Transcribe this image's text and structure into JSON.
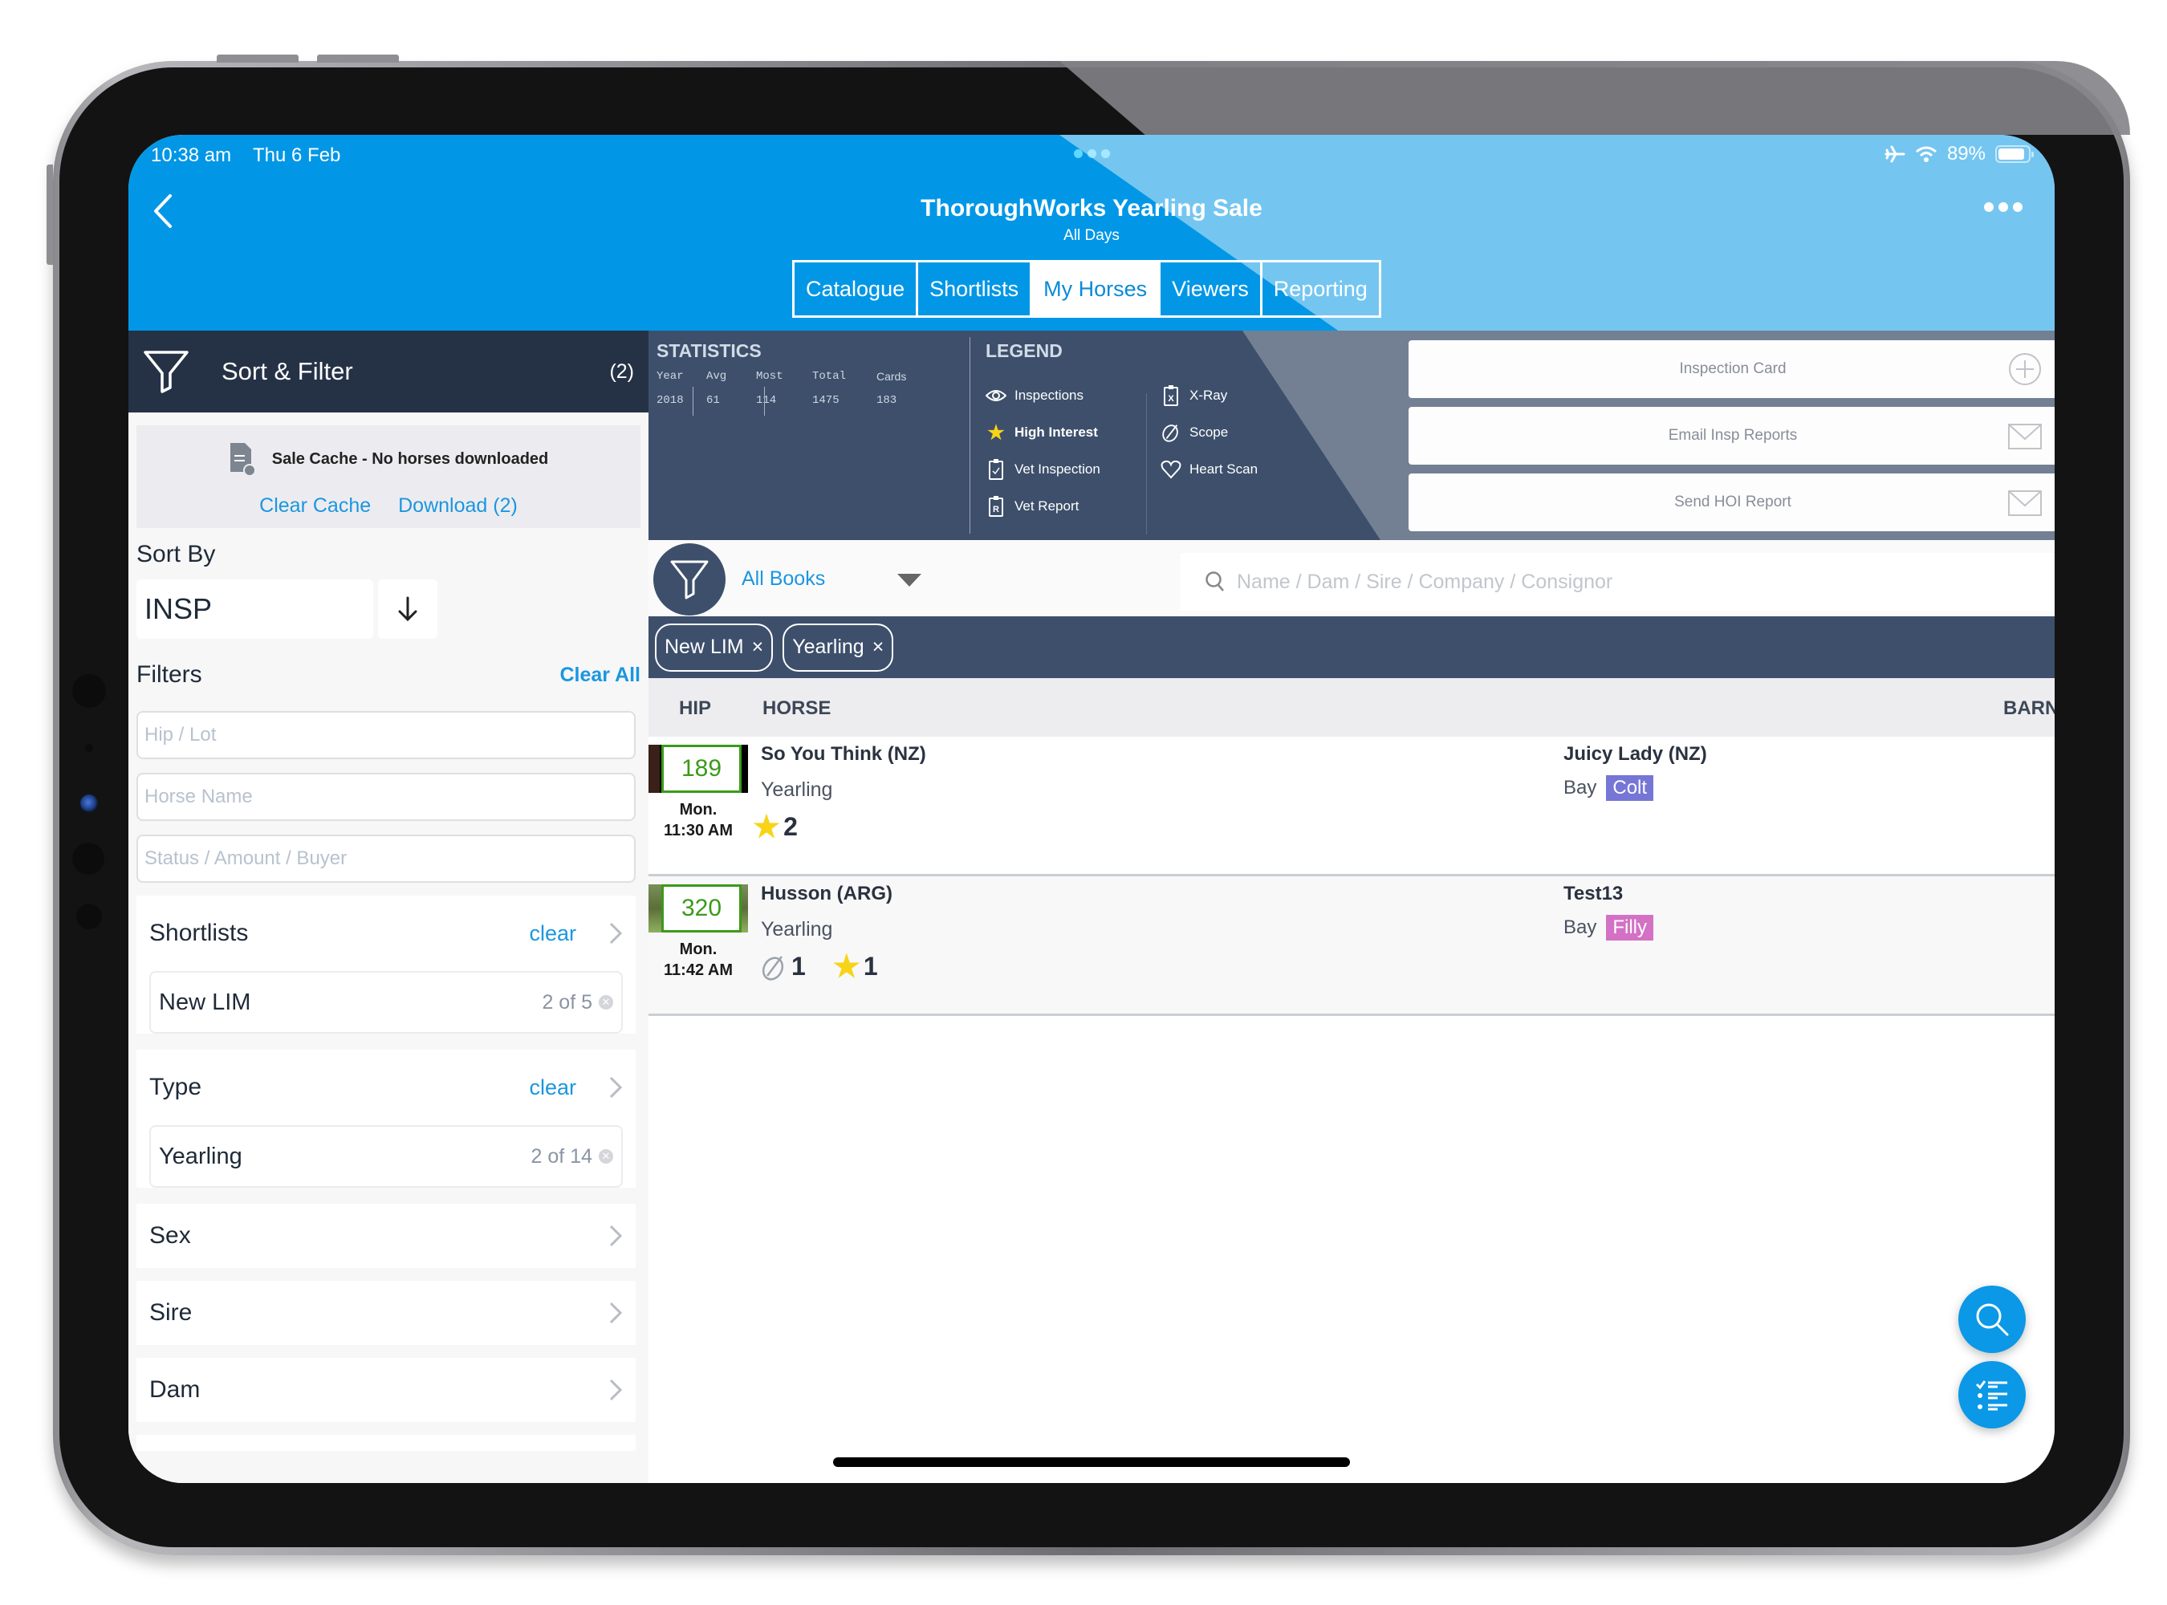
{
  "status_bar": {
    "time": "10:38 am",
    "date": "Thu 6 Feb",
    "battery": "89%",
    "battery_level_percent": 89
  },
  "header": {
    "title": "ThoroughWorks Yearling Sale",
    "subtitle": "All Days",
    "tabs": [
      {
        "label": "Catalogue",
        "active": false
      },
      {
        "label": "Shortlists",
        "active": false
      },
      {
        "label": "My Horses",
        "active": true
      },
      {
        "label": "Viewers",
        "active": false
      },
      {
        "label": "Reporting",
        "active": false
      }
    ]
  },
  "sidebar": {
    "title": "Sort & Filter",
    "count": "(2)",
    "cache": {
      "message": "Sale Cache - No horses downloaded",
      "clear_label": "Clear Cache",
      "download_label": "Download (2)"
    },
    "sort_by_label": "Sort By",
    "sort_value": "INSP",
    "sort_direction": "descending",
    "filters_label": "Filters",
    "clear_all_label": "Clear All",
    "fields": {
      "hip_placeholder": "Hip / Lot",
      "horse_placeholder": "Horse Name",
      "status_placeholder": "Status / Amount / Buyer"
    },
    "groups": [
      {
        "name": "Shortlists",
        "clear": "clear",
        "item": {
          "name": "New LIM",
          "count": "2 of 5"
        }
      },
      {
        "name": "Type",
        "clear": "clear",
        "item": {
          "name": "Yearling",
          "count": "2 of 14"
        }
      },
      {
        "name": "Sex"
      },
      {
        "name": "Sire"
      },
      {
        "name": "Dam"
      }
    ]
  },
  "statistics": {
    "title": "STATISTICS",
    "headers": [
      "Year",
      "Avg",
      "Most",
      "Total",
      "Cards"
    ],
    "values": [
      "2018",
      "61",
      "114",
      "1475",
      "183"
    ]
  },
  "legend": {
    "title": "LEGEND",
    "items": [
      {
        "icon": "eye-icon",
        "label": "Inspections"
      },
      {
        "icon": "star-icon",
        "label": "High Interest"
      },
      {
        "icon": "clipboard-check-icon",
        "label": "Vet Inspection"
      },
      {
        "icon": "clipboard-r-icon",
        "label": "Vet Report"
      },
      {
        "icon": "clipboard-x-icon",
        "label": "X-Ray"
      },
      {
        "icon": "scope-icon",
        "label": "Scope"
      },
      {
        "icon": "heart-icon",
        "label": "Heart Scan"
      }
    ]
  },
  "actions": [
    {
      "label": "Inspection Card",
      "icon": "plus-circle-icon"
    },
    {
      "label": "Email Insp Reports",
      "icon": "envelope-icon"
    },
    {
      "label": "Send HOI Report",
      "icon": "envelope-icon"
    }
  ],
  "filter_bar": {
    "books_label": "All Books",
    "search_placeholder": "Name / Dam / Sire / Company / Consignor"
  },
  "chips": [
    {
      "label": "New LIM"
    },
    {
      "label": "Yearling"
    }
  ],
  "table": {
    "columns": [
      "HIP",
      "HORSE",
      "BARN"
    ],
    "rows": [
      {
        "hip": "189",
        "day": "Mon.",
        "time": "11:30 AM",
        "sire": "So You Think (NZ)",
        "type": "Yearling",
        "scope_count": null,
        "star_count": "2",
        "dam": "Juicy Lady (NZ)",
        "color": "Bay",
        "sex": "Colt",
        "sex_color": "#7576d6"
      },
      {
        "hip": "320",
        "day": "Mon.",
        "time": "11:42 AM",
        "sire": "Husson (ARG)",
        "type": "Yearling",
        "scope_count": "1",
        "star_count": "1",
        "dam": "Test13",
        "color": "Bay",
        "sex": "Filly",
        "sex_color": "#d371c5"
      }
    ]
  },
  "colors": {
    "header_blue": "#0297e6",
    "navy": "#3d4f6b",
    "dark_navy": "#253246",
    "link_blue": "#1b96e0",
    "hip_green": "#3a9a1a",
    "star_yellow": "#f7d417"
  }
}
